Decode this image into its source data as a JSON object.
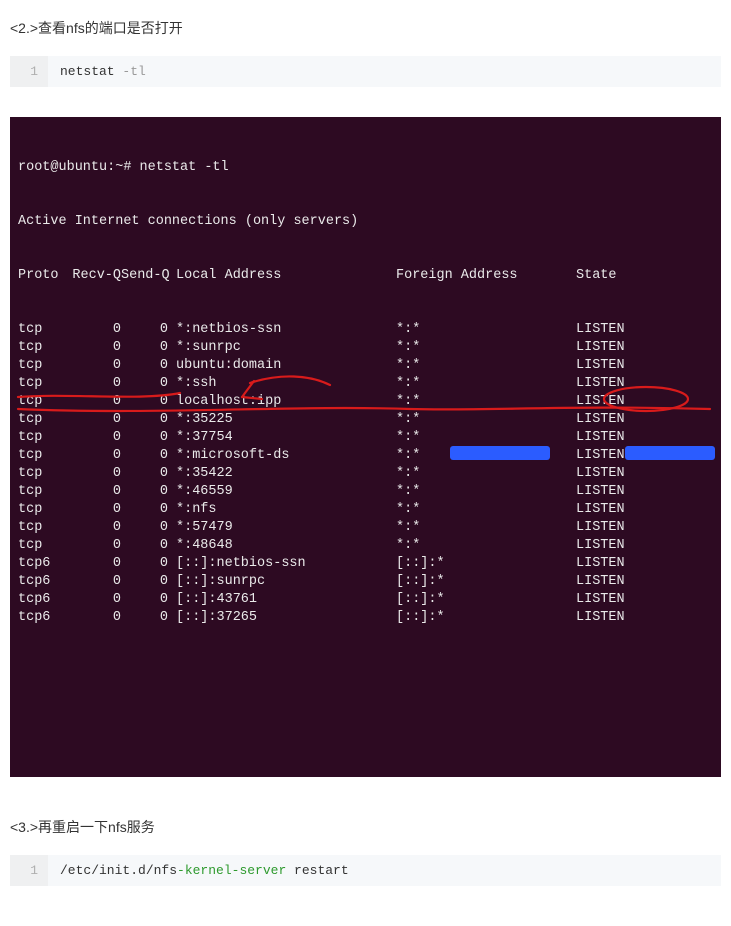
{
  "heading1": "<2.>查看nfs的端口是否打开",
  "codeblock1": {
    "lineno": "1",
    "cmd_base": "netstat ",
    "cmd_flag": "-tl"
  },
  "terminal": {
    "prompt": "root@ubuntu:~# netstat -tl",
    "subtitle": "Active Internet connections (only servers)",
    "headers": {
      "proto": "Proto",
      "recvq": "Recv-Q",
      "sendq": "Send-Q",
      "local": "Local Address",
      "foreign": "Foreign Address",
      "state": "State"
    },
    "rows": [
      {
        "proto": "tcp",
        "recvq": "0",
        "sendq": "0",
        "local": "*:netbios-ssn",
        "foreign": "*:*",
        "state": "LISTEN"
      },
      {
        "proto": "tcp",
        "recvq": "0",
        "sendq": "0",
        "local": "*:sunrpc",
        "foreign": "*:*",
        "state": "LISTEN"
      },
      {
        "proto": "tcp",
        "recvq": "0",
        "sendq": "0",
        "local": "ubuntu:domain",
        "foreign": "*:*",
        "state": "LISTEN"
      },
      {
        "proto": "tcp",
        "recvq": "0",
        "sendq": "0",
        "local": "*:ssh",
        "foreign": "*:*",
        "state": "LISTEN"
      },
      {
        "proto": "tcp",
        "recvq": "0",
        "sendq": "0",
        "local": "localhost:ipp",
        "foreign": "*:*",
        "state": "LISTEN"
      },
      {
        "proto": "tcp",
        "recvq": "0",
        "sendq": "0",
        "local": "*:35225",
        "foreign": "*:*",
        "state": "LISTEN"
      },
      {
        "proto": "tcp",
        "recvq": "0",
        "sendq": "0",
        "local": "*:37754",
        "foreign": "*:*",
        "state": "LISTEN"
      },
      {
        "proto": "tcp",
        "recvq": "0",
        "sendq": "0",
        "local": "*:microsoft-ds",
        "foreign": "*:*",
        "state": "LISTEN"
      },
      {
        "proto": "tcp",
        "recvq": "0",
        "sendq": "0",
        "local": "*:35422",
        "foreign": "*:*",
        "state": "LISTEN"
      },
      {
        "proto": "tcp",
        "recvq": "0",
        "sendq": "0",
        "local": "*:46559",
        "foreign": "*:*",
        "state": "LISTEN"
      },
      {
        "proto": "tcp",
        "recvq": "0",
        "sendq": "0",
        "local": "*:nfs",
        "foreign": "*:*",
        "state": "LISTEN"
      },
      {
        "proto": "tcp",
        "recvq": "0",
        "sendq": "0",
        "local": "*:57479",
        "foreign": "*:*",
        "state": "LISTEN"
      },
      {
        "proto": "tcp",
        "recvq": "0",
        "sendq": "0",
        "local": "*:48648",
        "foreign": "*:*",
        "state": "LISTEN"
      },
      {
        "proto": "tcp6",
        "recvq": "0",
        "sendq": "0",
        "local": "[::]:netbios-ssn",
        "foreign": "[::]:*",
        "state": "LISTEN"
      },
      {
        "proto": "tcp6",
        "recvq": "0",
        "sendq": "0",
        "local": "[::]:sunrpc",
        "foreign": "[::]:*",
        "state": "LISTEN"
      },
      {
        "proto": "tcp6",
        "recvq": "0",
        "sendq": "0",
        "local": "[::]:43761",
        "foreign": "[::]:*",
        "state": "LISTEN"
      },
      {
        "proto": "tcp6",
        "recvq": "0",
        "sendq": "0",
        "local": "[::]:37265",
        "foreign": "[::]:*",
        "state": "LISTEN"
      }
    ]
  },
  "heading2": "<3.>再重启一下nfs服务",
  "codeblock2": {
    "lineno": "1",
    "seg1": "/etc/init.d/nfs",
    "seg2": "-kernel-server",
    "seg3": " restart"
  }
}
